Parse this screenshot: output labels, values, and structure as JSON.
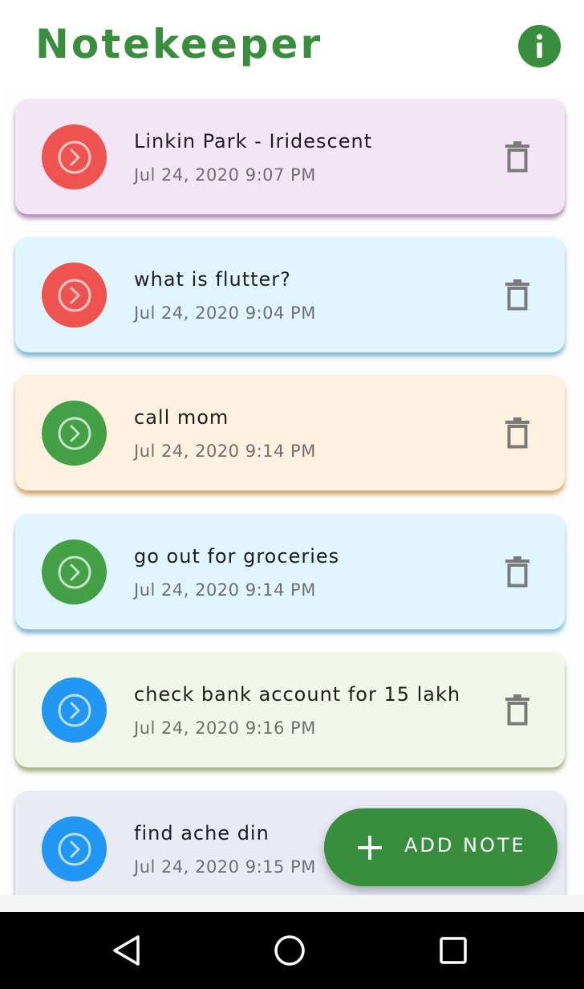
{
  "app": {
    "title": "Notekeeper",
    "accent_color": "#388e3c",
    "info_icon": "info-icon"
  },
  "notes": [
    {
      "title": "Linkin Park - Iridescent",
      "date": "Jul 24, 2020 9:07 PM",
      "background": "#f3e5f5",
      "shadow": "#ad8bb3",
      "status_color": "#ef5350"
    },
    {
      "title": "what is flutter?",
      "date": "Jul 24, 2020 9:04 PM",
      "background": "#e1f5fe",
      "shadow": "#7fb6d0",
      "status_color": "#ef5350"
    },
    {
      "title": "call mom",
      "date": "Jul 24, 2020 9:14 PM",
      "background": "#fff1e0",
      "shadow": "#cfa76d",
      "status_color": "#43a047"
    },
    {
      "title": "go out for groceries",
      "date": "Jul 24, 2020 9:14 PM",
      "background": "#e1f5fe",
      "shadow": "#7fb6d0",
      "status_color": "#43a047"
    },
    {
      "title": "check bank account for 15 lakh",
      "date": "Jul 24, 2020 9:16 PM",
      "background": "#f1f8e9",
      "shadow": "#9db07a",
      "status_color": "#2196f3"
    },
    {
      "title": "find ache din",
      "date": "Jul 24, 2020 9:15 PM",
      "background": "#e8eaf6",
      "shadow": "#9fa4c6",
      "status_color": "#2196f3"
    }
  ],
  "fab": {
    "label": "ADD NOTE",
    "icon": "plus-icon"
  },
  "navigation": {
    "back_icon": "back-icon",
    "home_icon": "home-icon",
    "recents_icon": "recents-icon"
  }
}
